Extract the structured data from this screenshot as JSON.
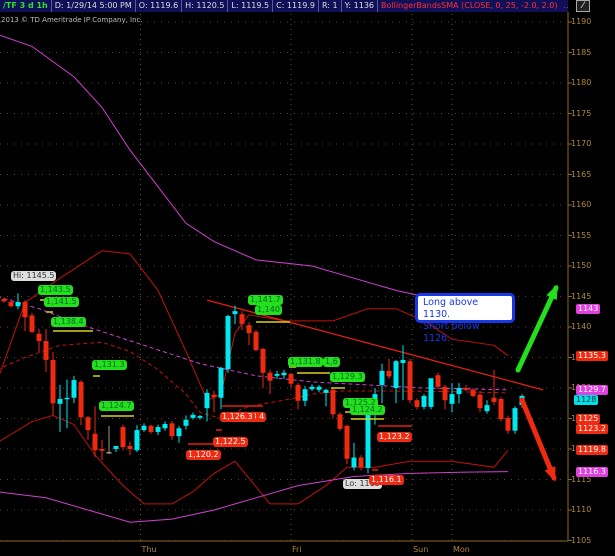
{
  "header": {
    "symbol": "/TF 3 d 1h",
    "date": "D: 1/29/14 5:00 PM",
    "open": "O: 1119.6",
    "high": "H: 1120.5",
    "low": "L: 1119.5",
    "close": "C: 1119.9",
    "range": "R: 1",
    "y": "Y: 1136",
    "study": "BollingerBandsSMA (CLOSE, 0, 25, -2.0, 2.0)",
    "more": "..."
  },
  "copyright": "2013 © TD Ameritrade IP Company, Inc.",
  "note": {
    "line1": "Long above 1130.",
    "line2": "Short below 1126."
  },
  "colors": {
    "up": "#00e8f0",
    "down": "#f02a10",
    "bb": "#c01408",
    "ma": "#d040d0",
    "grid": "#8a6a20",
    "green_arrow": "#22e01a",
    "red_arrow": "#f02a10"
  },
  "chart_data": {
    "type": "candlestick",
    "title": "/TF 3 d 1h",
    "ylim": [
      1105,
      1190
    ],
    "yticks": [
      1105,
      1110,
      1115,
      1120,
      1125,
      1130,
      1135,
      1140,
      1145,
      1150,
      1155,
      1160,
      1165,
      1170,
      1175,
      1180,
      1185,
      1190
    ],
    "xlabels": [
      {
        "label": "Thu",
        "index": 19.5
      },
      {
        "label": "Fri",
        "index": 41
      },
      {
        "label": "Sun",
        "index": 58.3
      },
      {
        "label": "Mon",
        "index": 64
      }
    ],
    "candles": [
      [
        1144.6,
        1144.8,
        1144.0,
        1144.2
      ],
      [
        1144.1,
        1144.6,
        1143.2,
        1143.4
      ],
      [
        1143.4,
        1145.5,
        1142.9,
        1144.1
      ],
      [
        1144.1,
        1144.4,
        1139.3,
        1141.6
      ],
      [
        1141.9,
        1142.3,
        1139.0,
        1139.2
      ],
      [
        1138.9,
        1139.7,
        1135.9,
        1137.7
      ],
      [
        1137.7,
        1139.7,
        1132.6,
        1134.6
      ],
      [
        1134.6,
        1135.9,
        1125.6,
        1127.5
      ],
      [
        1127.4,
        1130.5,
        1122.8,
        1128.2
      ],
      [
        1128.2,
        1131.4,
        1123.4,
        1128.4
      ],
      [
        1128.4,
        1132.0,
        1127.5,
        1131.3
      ],
      [
        1131.0,
        1131.3,
        1123.9,
        1125.2
      ],
      [
        1125.2,
        1125.4,
        1121.5,
        1123.1
      ],
      [
        1122.5,
        1127.0,
        1118.7,
        1119.8
      ],
      [
        1120.0,
        1121.5,
        1118.2,
        1119.7
      ],
      [
        1119.5,
        1123.8,
        1119.2,
        1119.5
      ],
      [
        1120.0,
        1120.5,
        1119.5,
        1120.5
      ],
      [
        1123.6,
        1124.0,
        1119.8,
        1120.3
      ],
      [
        1120.5,
        1121.2,
        1119.0,
        1120.0
      ],
      [
        1119.8,
        1123.9,
        1119.5,
        1123.1
      ],
      [
        1123.1,
        1124.2,
        1122.8,
        1123.8
      ],
      [
        1123.8,
        1124.0,
        1122.5,
        1122.8
      ],
      [
        1122.8,
        1124.0,
        1122.3,
        1123.6
      ],
      [
        1123.4,
        1124.5,
        1123.0,
        1124.1
      ],
      [
        1124.2,
        1124.6,
        1121.5,
        1122.1
      ],
      [
        1122.1,
        1123.8,
        1121.0,
        1123.4
      ],
      [
        1123.8,
        1125.5,
        1123.2,
        1124.8
      ],
      [
        1125.1,
        1126.0,
        1124.8,
        1125.6
      ],
      [
        1125.1,
        1125.6,
        1124.8,
        1125.4
      ],
      [
        1126.7,
        1129.8,
        1124.5,
        1129.2
      ],
      [
        1128.9,
        1129.5,
        1126.0,
        1128.5
      ],
      [
        1128.4,
        1133.5,
        1126.5,
        1133.3
      ],
      [
        1133.1,
        1142.0,
        1132.5,
        1141.8
      ],
      [
        1142.1,
        1143.5,
        1140.5,
        1142.6
      ],
      [
        1142.1,
        1142.6,
        1139.5,
        1140.5
      ],
      [
        1140.3,
        1140.8,
        1137.0,
        1139.0
      ],
      [
        1139.2,
        1139.5,
        1136.0,
        1136.2
      ],
      [
        1136.4,
        1136.6,
        1130.0,
        1132.5
      ],
      [
        1132.5,
        1133.0,
        1129.0,
        1131.2
      ],
      [
        1132.0,
        1132.8,
        1131.5,
        1132.3
      ],
      [
        1132.1,
        1133.0,
        1131.5,
        1132.5
      ],
      [
        1132.3,
        1132.5,
        1130.0,
        1130.7
      ],
      [
        1130.5,
        1130.8,
        1126.5,
        1127.9
      ],
      [
        1127.9,
        1130.3,
        1127.0,
        1129.8
      ],
      [
        1129.8,
        1130.6,
        1129.5,
        1130.2
      ],
      [
        1129.7,
        1130.5,
        1129.3,
        1130.2
      ],
      [
        1129.2,
        1129.9,
        1127.0,
        1129.7
      ],
      [
        1129.7,
        1130.0,
        1125.0,
        1125.7
      ],
      [
        1125.7,
        1126.0,
        1123.0,
        1123.3
      ],
      [
        1123.8,
        1124.0,
        1117.5,
        1118.4
      ],
      [
        1117.0,
        1121.0,
        1116.5,
        1118.6
      ],
      [
        1118.6,
        1119.0,
        1116.5,
        1117.0
      ],
      [
        1116.9,
        1128.0,
        1116.0,
        1127.0
      ],
      [
        1127.2,
        1130.0,
        1124.0,
        1129.0
      ],
      [
        1130.5,
        1134.0,
        1127.5,
        1132.8
      ],
      [
        1132.8,
        1134.8,
        1131.5,
        1131.9
      ],
      [
        1130.0,
        1134.6,
        1127.5,
        1134.4
      ],
      [
        1134.1,
        1137.0,
        1128.0,
        1134.6
      ],
      [
        1134.4,
        1134.8,
        1127.5,
        1128.0
      ],
      [
        1128.0,
        1128.3,
        1126.5,
        1126.9
      ],
      [
        1126.9,
        1129.0,
        1126.5,
        1128.7
      ],
      [
        1126.9,
        1131.5,
        1126.5,
        1131.6
      ],
      [
        1132.1,
        1132.5,
        1129.8,
        1130.2
      ],
      [
        1130.2,
        1130.5,
        1126.5,
        1128.0
      ],
      [
        1127.4,
        1130.8,
        1126.0,
        1129.0
      ],
      [
        1129.0,
        1130.8,
        1127.5,
        1130.0
      ],
      [
        1130.0,
        1130.5,
        1129.5,
        1129.7
      ],
      [
        1129.7,
        1130.0,
        1128.5,
        1128.7
      ],
      [
        1128.9,
        1129.5,
        1126.0,
        1126.7
      ],
      [
        1126.2,
        1128.0,
        1125.8,
        1127.2
      ],
      [
        1128.4,
        1133.0,
        1127.2,
        1127.7
      ],
      [
        1128.2,
        1128.5,
        1124.5,
        1124.9
      ],
      [
        1125.1,
        1125.5,
        1122.5,
        1123.0
      ],
      [
        1123.0,
        1127.0,
        1122.5,
        1126.7
      ],
      [
        1127.2,
        1129.0,
        1126.8,
        1128.7
      ]
    ],
    "series": [
      {
        "name": "upper_band",
        "style": "solid",
        "color": "#c01408",
        "points": [
          [
            -1,
            1131
          ],
          [
            3,
            1144
          ],
          [
            8,
            1148
          ],
          [
            14,
            1152.5
          ],
          [
            18,
            1152
          ],
          [
            22,
            1146
          ],
          [
            26,
            1136
          ],
          [
            29,
            1128
          ],
          [
            31,
            1129
          ],
          [
            33,
            1139
          ],
          [
            35,
            1142
          ],
          [
            40,
            1141
          ],
          [
            47,
            1141
          ],
          [
            52,
            1143
          ],
          [
            56,
            1143
          ],
          [
            60,
            1141
          ],
          [
            64,
            1138
          ],
          [
            70,
            1137
          ],
          [
            72,
            1135.3
          ]
        ]
      },
      {
        "name": "lower_band",
        "style": "solid",
        "color": "#c01408",
        "points": [
          [
            -1,
            1121
          ],
          [
            4,
            1124.5
          ],
          [
            7,
            1125.5
          ],
          [
            10,
            1124
          ],
          [
            13,
            1119
          ],
          [
            17,
            1114
          ],
          [
            20,
            1111
          ],
          [
            24,
            1111
          ],
          [
            27,
            1113
          ],
          [
            30,
            1116
          ],
          [
            33,
            1118
          ],
          [
            38,
            1111
          ],
          [
            42,
            1111
          ],
          [
            46,
            1114
          ],
          [
            49,
            1117
          ],
          [
            53,
            1117
          ],
          [
            58,
            1118
          ],
          [
            64,
            1118
          ],
          [
            70,
            1117
          ],
          [
            72,
            1119.8
          ]
        ]
      },
      {
        "name": "middle_band",
        "style": "dashed",
        "color": "#c01408",
        "points": [
          [
            -1,
            1133
          ],
          [
            3,
            1135
          ],
          [
            8,
            1137
          ],
          [
            14,
            1137.5
          ],
          [
            18,
            1136
          ],
          [
            22,
            1133
          ],
          [
            26,
            1129
          ],
          [
            28,
            1126
          ],
          [
            31,
            1125
          ],
          [
            35,
            1127
          ],
          [
            40,
            1128
          ],
          [
            44,
            1129
          ],
          [
            48,
            1129.5
          ],
          [
            56,
            1129.5
          ],
          [
            64,
            1129.4
          ],
          [
            72,
            1129.2
          ]
        ]
      },
      {
        "name": "ma_dashed",
        "style": "dashed",
        "color": "#d040d0",
        "points": [
          [
            -1,
            1145
          ],
          [
            5,
            1143
          ],
          [
            12,
            1140
          ],
          [
            20,
            1137
          ],
          [
            28,
            1134
          ],
          [
            36,
            1132
          ],
          [
            44,
            1131
          ],
          [
            52,
            1130.5
          ],
          [
            60,
            1130
          ],
          [
            72,
            1129.7
          ]
        ]
      },
      {
        "name": "ma_upper",
        "style": "solid",
        "color": "#d040d0",
        "points": [
          [
            -1,
            1188
          ],
          [
            4,
            1186
          ],
          [
            10,
            1181
          ],
          [
            14,
            1176
          ],
          [
            18,
            1169
          ],
          [
            22,
            1163
          ],
          [
            26,
            1157
          ],
          [
            30,
            1154
          ],
          [
            36,
            1151
          ],
          [
            44,
            1150
          ],
          [
            50,
            1148
          ],
          [
            56,
            1146
          ],
          [
            64,
            1144
          ],
          [
            72,
            1143
          ]
        ]
      },
      {
        "name": "ma_lower",
        "style": "solid",
        "color": "#d040d0",
        "points": [
          [
            -1,
            1113
          ],
          [
            6,
            1112
          ],
          [
            12,
            1110
          ],
          [
            18,
            1108
          ],
          [
            24,
            1108.5
          ],
          [
            30,
            1110
          ],
          [
            36,
            1112
          ],
          [
            42,
            1114
          ],
          [
            50,
            1115.5
          ],
          [
            58,
            1116
          ],
          [
            66,
            1116.2
          ],
          [
            72,
            1116.3
          ]
        ]
      },
      {
        "name": "trendline",
        "style": "solid",
        "color": "#e02010",
        "points": [
          [
            29,
            1144.4
          ],
          [
            77,
            1129.7
          ]
        ]
      }
    ],
    "annotations": {
      "hi": "Hi: 1145.5",
      "lo": "Lo: 1115",
      "green": [
        "1,143.5",
        "1,141.5",
        "1,138.4",
        "1,131.3",
        "1,124.7",
        "1,141.7",
        "1,140",
        "1,131.8",
        "1,6",
        "1,129.3",
        "1,125.2",
        "1,124.2"
      ],
      "red": [
        "1,126.3 4",
        "1,126.3",
        "1,122.5",
        "1,120.2",
        "1,123.2",
        "1,116.1"
      ]
    },
    "price_badges": [
      {
        "value": "1143",
        "color": "#e040e0"
      },
      {
        "value": "1135.3",
        "color": "#f02a10"
      },
      {
        "value": "1129.7",
        "color": "#e040e0"
      },
      {
        "value": "1125",
        "color": "#f02a10"
      },
      {
        "value": "1128",
        "color": "#00e0e8"
      },
      {
        "value": "1123.2",
        "color": "#f02a10"
      },
      {
        "value": "1119.8",
        "color": "#f02a10"
      },
      {
        "value": "1116.3",
        "color": "#e040e0"
      }
    ]
  }
}
